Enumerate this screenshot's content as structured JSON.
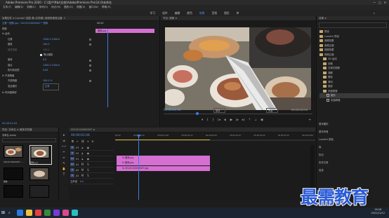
{
  "app": {
    "title": "Adobe Premiere Pro 2020 - C:\\用户\\ftbz\\文档\\Adobe\\Premiere Pro\\14.0\\未命名",
    "window_controls": [
      "—",
      "□",
      "✕"
    ]
  },
  "menu": [
    "文件(F)",
    "编辑(E)",
    "剪辑(C)",
    "序列(S)",
    "标记(M)",
    "图形(G)",
    "视图(V)",
    "窗口(W)",
    "帮助(H)"
  ],
  "workspaces": [
    {
      "label": "学习",
      "active": false
    },
    {
      "label": "组件",
      "active": false
    },
    {
      "label": "编辑",
      "active": false
    },
    {
      "label": "颜色",
      "active": false
    },
    {
      "label": "效果",
      "active": true
    },
    {
      "label": "音频",
      "active": false
    },
    {
      "label": "图形",
      "active": false
    },
    {
      "label": "库",
      "active": false
    }
  ],
  "effect_controls": {
    "tabs": "效果控件 ≡   Lumetri 范围   源:(无剪辑)   音频剪辑混合器: 2",
    "source": "主要 * 图像.jpg  ›  001/0120000007 * 图像",
    "timecode_start": "00:00",
    "clip_label": "图像.jpg",
    "sections": [
      "视频",
      "fx 运动"
    ],
    "rows": [
      {
        "label": "位置",
        "value": "1500.0  1000.0"
      },
      {
        "label": "缩放",
        "value": "100.0"
      },
      {
        "label": "缩放宽度",
        "value": "100.0"
      },
      {
        "label": "等比缩放",
        "value": ""
      },
      {
        "label": "旋转",
        "value": "0.0"
      },
      {
        "label": "锚点",
        "value": "1500.0  1000.0"
      },
      {
        "label": "防闪烁滤镜",
        "value": "0.00"
      },
      {
        "label": "fx 不透明度",
        "value": ""
      },
      {
        "label": "不透明度",
        "value": "100.0 %"
      },
      {
        "label": "混合模式",
        "value": "正常"
      },
      {
        "label": "fx 时间重映射",
        "value": ""
      }
    ],
    "timecode": "00:00:01:04"
  },
  "program": {
    "tab": "节目: 图像 ≡",
    "timecode_current": "00:00:01:04",
    "fit": "适合",
    "quality": "完整",
    "duration": "00:00:02:03"
  },
  "project": {
    "tabs": "项目: 未命名 ≡   媒体浏览器",
    "path": "未命名.prproj",
    "items": [
      {
        "name": "001/0120000007 ..."
      },
      {
        "name": "图像.jpg"
      },
      {
        "name": "图像"
      },
      {
        "name": ""
      },
      {
        "name": ""
      }
    ]
  },
  "timeline": {
    "tab": "001/0120000007 ≡",
    "timecode": "00:00:01:04",
    "ruler": [
      "00:00",
      "00:00:00:15",
      "00:00:01:00",
      "00:00:01:15",
      "00:00:02:00",
      "00:00:02:15",
      "00:00:03:00",
      "00:00:03:15",
      "00:00:04:00"
    ],
    "video_tracks": [
      "V3",
      "V2",
      "V1"
    ],
    "audio_tracks": [
      "A1",
      "A2",
      "A3"
    ],
    "master": "主声道",
    "master_value": "0.0",
    "clips": [
      {
        "label": "fx 图像.jpg",
        "track": "V3"
      },
      {
        "label": "fx 图像.jpg",
        "track": "V2"
      },
      {
        "label": "fx 001/0120000007.jpg",
        "track": "V1"
      }
    ]
  },
  "effects": {
    "tab": "效果 ≡",
    "items": [
      "预设",
      "Lumetri 预设",
      "音频效果",
      "音频过渡",
      "视频效果",
      "视频过渡",
      "3D 运动",
      "划像",
      "沉浸式视频",
      "溶解",
      "擦除",
      "滑动",
      "缩放",
      "页面剥落",
      "翻页",
      "页面剥落"
    ],
    "selected": "翻页",
    "bottom": [
      "基本图形",
      "基本声音",
      "Lumetri 颜色",
      "库",
      "标记",
      "历史记录",
      "信息"
    ]
  },
  "taskbar": {
    "time": "16:26",
    "date": "2021/11/12",
    "icon_colors": [
      "#2a7ad8",
      "#f0c040",
      "#e84040",
      "#3a8a3a",
      "#7a3ad8",
      "#d84a8a",
      "#2ac0c0"
    ]
  },
  "watermark": "最需教育"
}
